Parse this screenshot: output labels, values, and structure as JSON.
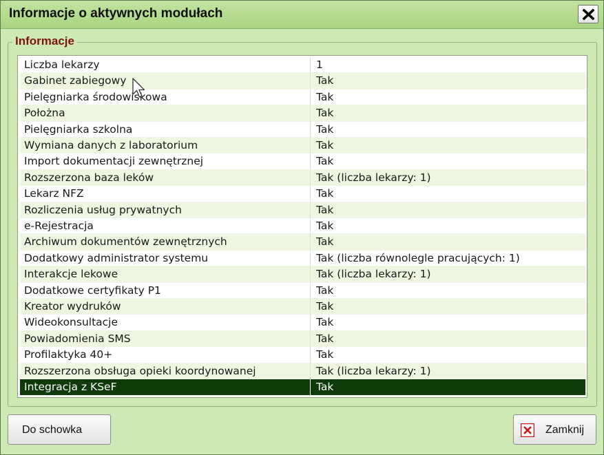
{
  "window": {
    "title": "Informacje o aktywnych modułach",
    "close_icon": "close-x-icon"
  },
  "group": {
    "legend": "Informacje"
  },
  "modules": [
    {
      "name": "Liczba lekarzy",
      "value": "1"
    },
    {
      "name": "Gabinet zabiegowy",
      "value": "Tak"
    },
    {
      "name": "Pielęgniarka środowiskowa",
      "value": "Tak"
    },
    {
      "name": "Położna",
      "value": "Tak"
    },
    {
      "name": "Pielęgniarka szkolna",
      "value": "Tak"
    },
    {
      "name": "Wymiana danych z laboratorium",
      "value": "Tak"
    },
    {
      "name": "Import dokumentacji zewnętrznej",
      "value": "Tak"
    },
    {
      "name": "Rozszerzona baza leków",
      "value": "Tak (liczba lekarzy: 1)"
    },
    {
      "name": "Lekarz NFZ",
      "value": "Tak"
    },
    {
      "name": "Rozliczenia usług prywatnych",
      "value": "Tak"
    },
    {
      "name": "e-Rejestracja",
      "value": "Tak"
    },
    {
      "name": "Archiwum dokumentów zewnętrznych",
      "value": "Tak"
    },
    {
      "name": "Dodatkowy administrator systemu",
      "value": "Tak (liczba równolegle pracujących: 1)"
    },
    {
      "name": "Interakcje lekowe",
      "value": "Tak (liczba lekarzy: 1)"
    },
    {
      "name": "Dodatkowe certyfikaty P1",
      "value": "Tak"
    },
    {
      "name": "Kreator wydruków",
      "value": "Tak"
    },
    {
      "name": "Wideokonsultacje",
      "value": "Tak"
    },
    {
      "name": "Powiadomienia SMS",
      "value": "Tak"
    },
    {
      "name": "Profilaktyka 40+",
      "value": "Tak"
    },
    {
      "name": "Rozszerzona obsługa opieki koordynowanej",
      "value": "Tak (liczba lekarzy: 1)"
    },
    {
      "name": "Integracja z KSeF",
      "value": "Tak"
    }
  ],
  "selected_row": "Integracja z KSeF",
  "buttons": {
    "copy_label": "Do schowka",
    "close_label": "Zamknij",
    "close_icon": "red-x-icon"
  },
  "colors": {
    "window_bg": "#cfe9b4",
    "legend_text": "#7d1414",
    "selected_row_bg": "#0f3a0a",
    "alt_row_bg": "#eef6e1"
  }
}
